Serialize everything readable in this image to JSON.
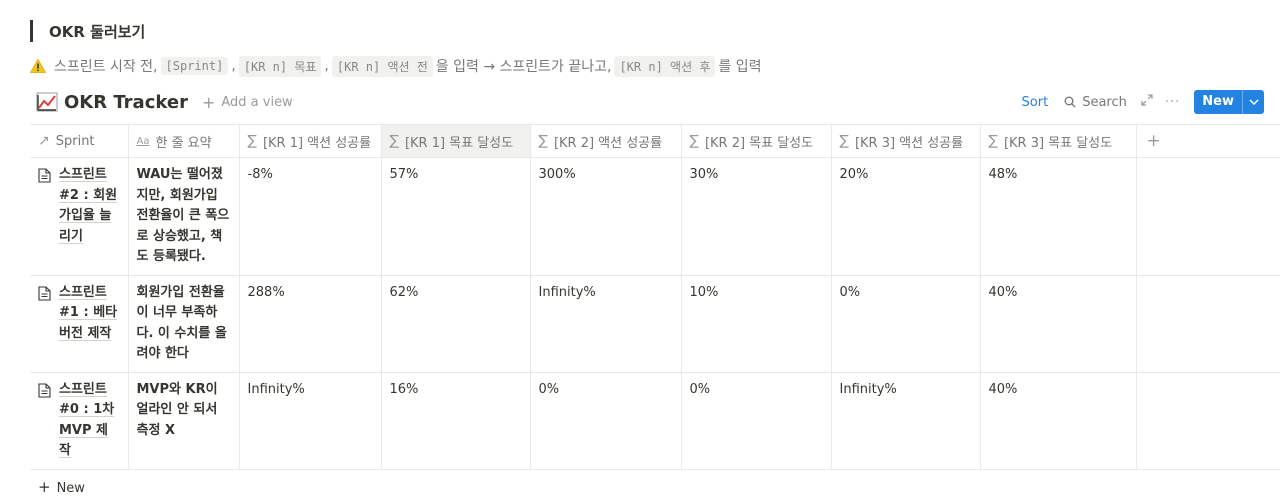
{
  "heading": {
    "title": "OKR 둘러보기"
  },
  "callout": {
    "icon": "warning-icon",
    "text1": "스프린트 시작 전,",
    "code1": "[Sprint]",
    "sep1": ",",
    "code2": "[KR n] 목표",
    "sep2": ",",
    "code3": "[KR n] 액션 전",
    "text2": "을 입력 → 스프린트가 끝나고,",
    "code4": "[KR n] 액션 후",
    "text3": "를 입력"
  },
  "database": {
    "title": "OKR Tracker",
    "icon": "chart-trend-icon",
    "add_view": "Add a view"
  },
  "toolbar": {
    "sort": "Sort",
    "search": "Search",
    "more": "···",
    "new": "New"
  },
  "table": {
    "columns": [
      {
        "icon": "↗",
        "label": "Sprint"
      },
      {
        "icon": "Aa",
        "label": "한 줄 요약"
      },
      {
        "icon": "∑",
        "label": "[KR 1] 액션 성공률"
      },
      {
        "icon": "∑",
        "label": "[KR 1] 목표 달성도"
      },
      {
        "icon": "∑",
        "label": "[KR 2] 액션 성공률"
      },
      {
        "icon": "∑",
        "label": "[KR 2] 목표 달성도"
      },
      {
        "icon": "∑",
        "label": "[KR 3] 액션 성공률"
      },
      {
        "icon": "∑",
        "label": "[KR 3] 목표 달성도"
      }
    ],
    "add_column": "+",
    "rows": [
      {
        "sprint": "스프린트#2 : 회원가입율 늘리기",
        "summary": "WAU는 떨어졌지만, 회원가입 전환율이 큰 폭으로 상승했고, 책도 등록됐다.",
        "values": [
          "-8%",
          "57%",
          "300%",
          "30%",
          "20%",
          "48%"
        ]
      },
      {
        "sprint": "스프린트#1 : 베타 버전 제작",
        "summary": "회원가입 전환율이 너무 부족하다. 이 수치를 올려야 한다",
        "values": [
          "288%",
          "62%",
          "Infinity%",
          "10%",
          "0%",
          "40%"
        ]
      },
      {
        "sprint": "스프린트#0 : 1차 MVP 제작",
        "summary": "MVP와 KR이 얼라인 안 되서 측정 X",
        "values": [
          "Infinity%",
          "16%",
          "0%",
          "0%",
          "Infinity%",
          "40%"
        ]
      }
    ],
    "new_row": "New"
  },
  "colors": {
    "accent": "#2383e2",
    "text": "#37352f",
    "muted": "#787774",
    "border": "#e9e9e7"
  }
}
